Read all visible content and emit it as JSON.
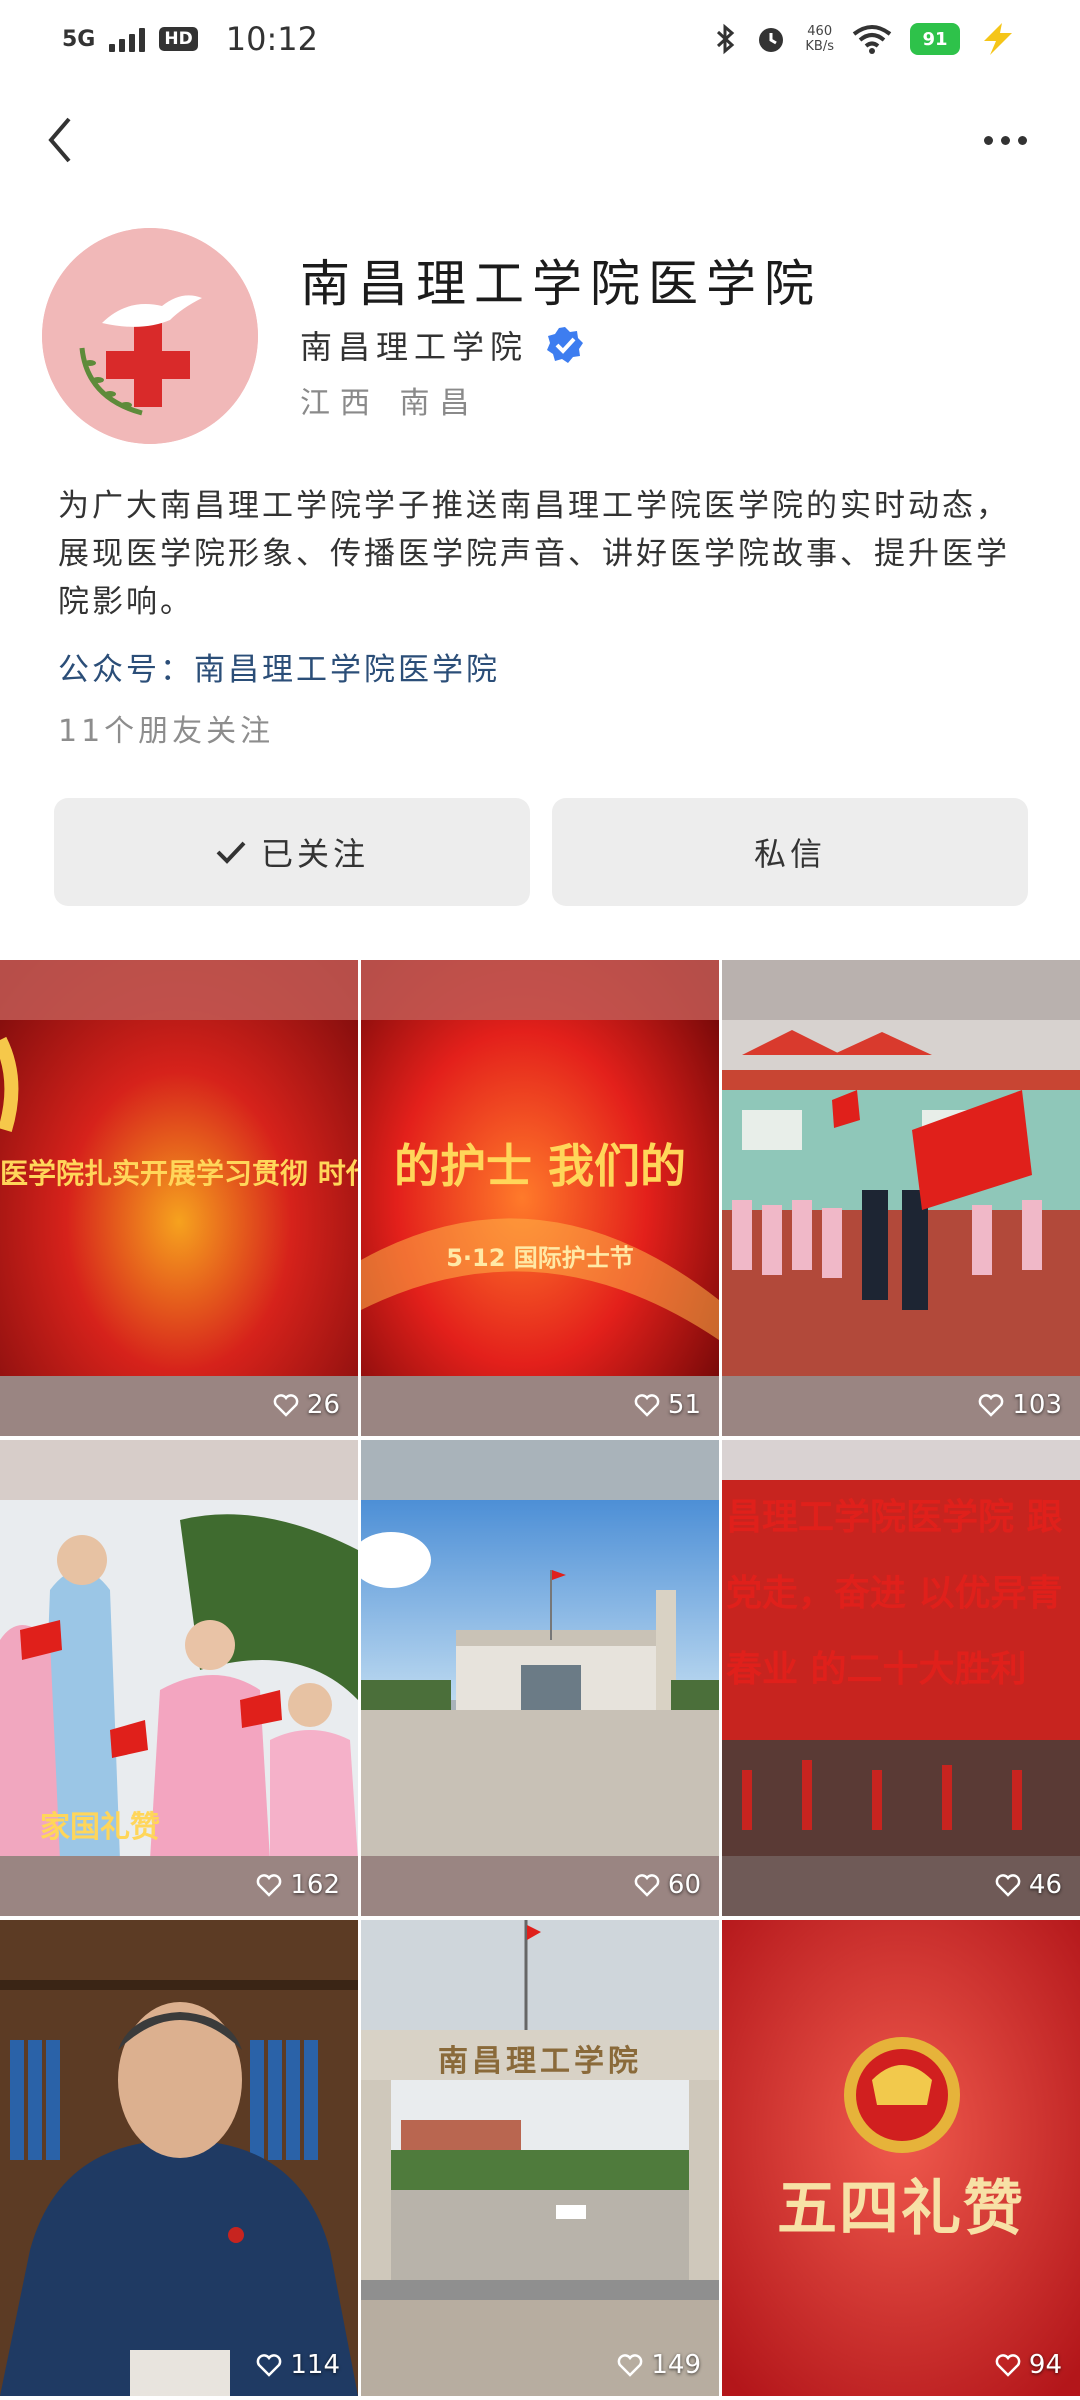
{
  "status_bar": {
    "network": "5G",
    "hd": "HD",
    "time": "10:12",
    "speed_value": "460",
    "speed_unit": "KB/s",
    "battery": "91"
  },
  "profile": {
    "title": "南昌理工学院医学院",
    "org_name": "南昌理工学院",
    "location": "江西 南昌",
    "description": "为广大南昌理工学院学子推送南昌理工学院医学院的实时动态，展现医学院形象、传播医学院声音、讲好医学院故事、提升医学院影响。",
    "account": "公众号：南昌理工学院医学院",
    "friends": "11个朋友关注"
  },
  "actions": {
    "follow_label": "已关注",
    "message_label": "私信"
  },
  "videos": [
    {
      "likes": "26",
      "caption": "医学院扎实开展学习贯彻 时代中国特色社会主义思想 五一二国际护士节系列活动"
    },
    {
      "likes": "51",
      "caption": "的护士 我们的",
      "sub": "5·12 国际护士节"
    },
    {
      "likes": "103"
    },
    {
      "likes": "162",
      "caption": "家国礼赞"
    },
    {
      "likes": "60"
    },
    {
      "likes": "46",
      "caption": "昌理工学院医学院 跟党走，奋进 以优异青春业 的二十大胜利"
    },
    {
      "likes": "114"
    },
    {
      "likes": "149",
      "caption": "南昌理工学院"
    },
    {
      "likes": "94",
      "caption": "五四礼赞"
    }
  ],
  "colors": {
    "accent_blue": "#3d7df0",
    "link_blue": "#2b4e78",
    "button_bg": "#ededed",
    "avatar_bg": "#f1b8b8"
  },
  "icons": [
    "back-icon",
    "more-icon",
    "verified-icon",
    "check-icon",
    "heart-icon",
    "bluetooth-icon",
    "alarm-icon",
    "wifi-icon"
  ]
}
